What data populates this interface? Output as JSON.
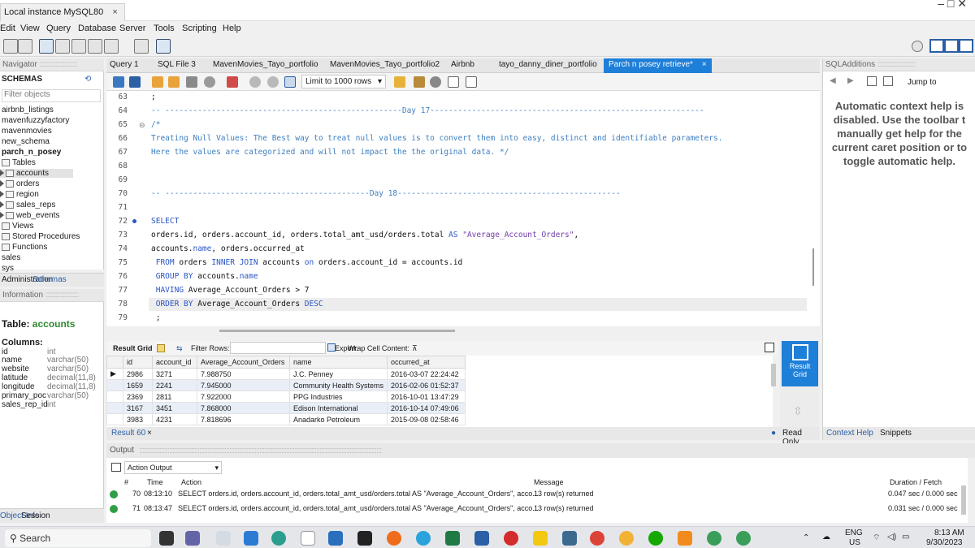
{
  "window": {
    "tab_title": "Local instance MySQL80",
    "tab_close": "×",
    "controls": "–   □   ✕"
  },
  "menu": [
    "Edit",
    "View",
    "Query",
    "Database",
    "Server",
    "Tools",
    "Scripting",
    "Help"
  ],
  "navigator": {
    "header": "Navigator",
    "schemas_label": "SCHEMAS",
    "filter_placeholder": "Filter objects",
    "items": [
      "airbnb_listings",
      "mavenfuzzyfactory",
      "mavenmovies",
      "new_schema",
      "parch_n_posey"
    ],
    "tables_label": "Tables",
    "tables": [
      "accounts",
      "orders",
      "region",
      "sales_reps",
      "web_events"
    ],
    "views_label": "Views",
    "procs_label": "Stored Procedures",
    "funcs_label": "Functions",
    "other": [
      "sales",
      "sys"
    ],
    "tabs": [
      "Administration",
      "Schemas"
    ]
  },
  "info": {
    "header": "Information",
    "table_label": "Table:",
    "table_name": "accounts",
    "columns_label": "Columns:",
    "columns": [
      {
        "name": "id",
        "type": "int"
      },
      {
        "name": "name",
        "type": "varchar(50)"
      },
      {
        "name": "website",
        "type": "varchar(50)"
      },
      {
        "name": "latitude",
        "type": "decimal(11,8)"
      },
      {
        "name": "longitude",
        "type": "decimal(11,8)"
      },
      {
        "name": "primary_poc",
        "type": "varchar(50)"
      },
      {
        "name": "sales_rep_id",
        "type": "int"
      }
    ],
    "tabs": [
      "Object Info",
      "Session"
    ]
  },
  "query_tabs": [
    "Query 1",
    "SQL File 3",
    "MavenMovies_Tayo_portfolio",
    "MavenMovies_Tayo_portfolio2",
    "Airbnb",
    "tayo_danny_diner_portfolio",
    "Parch n posey retrieve*"
  ],
  "editor_toolbar": {
    "limit": "Limit to 1000 rows"
  },
  "editor": {
    "line_numbers": [
      "63",
      "64",
      "65",
      "66",
      "67",
      "68",
      "69",
      "70",
      "71",
      "72",
      "73",
      "74",
      "75",
      "76",
      "77",
      "78",
      "79"
    ],
    "l63": ";",
    "l64": "-- ---------------------------------------------------Day 17-----------------------------------------------------------",
    "l65": "/*",
    "l66": "Treating Null Values: The Best way to treat null values is to convert them into easy, distinct and identifiable parameters.",
    "l67": "Here the values are categorized and will not impact the the original data. */",
    "l70": "-- --------------------------------------------Day 18------------------------------------------------",
    "l72_kw": "SELECT",
    "l73_a": "orders.id, orders.account_id, orders.total_amt_usd/orders.total ",
    "l73_kw": "AS",
    "l73_str": " \"Average_Account_Orders\"",
    "l73_b": ",",
    "l74_a": "accounts.",
    "l74_kw": "name",
    "l74_b": ", orders.occurred_at",
    "l75_kw1": " FROM",
    "l75_a": " orders ",
    "l75_kw2": "INNER JOIN",
    "l75_b": " accounts ",
    "l75_kw3": "on",
    "l75_c": " orders.account_id = accounts.id",
    "l76_kw": " GROUP BY",
    "l76_a": " accounts.",
    "l76_kw2": "name",
    "l77_kw": " HAVING",
    "l77_a": " Average_Account_Orders > 7",
    "l78_kw": " ORDER BY",
    "l78_a": " Average_Account_Orders ",
    "l78_kw2": "DESC",
    "l79": " ;"
  },
  "result_toolbar": {
    "grid": "Result Grid",
    "filter": "Filter Rows:",
    "export": "Export:",
    "wrap": "Wrap Cell Content:"
  },
  "result": {
    "columns": [
      "id",
      "account_id",
      "Average_Account_Orders",
      "name",
      "occurred_at"
    ],
    "rows": [
      [
        "2986",
        "3271",
        "7.988750",
        "J.C. Penney",
        "2016-03-07 22:24:42"
      ],
      [
        "1659",
        "2241",
        "7.945000",
        "Community Health Systems",
        "2016-02-06 01:52:37"
      ],
      [
        "2369",
        "2811",
        "7.922000",
        "PPG Industries",
        "2016-10-01 13:47:29"
      ],
      [
        "3167",
        "3451",
        "7.868000",
        "Edison International",
        "2016-10-14 07:49:06"
      ],
      [
        "3983",
        "4231",
        "7.818696",
        "Anadarko Petroleum",
        "2015-09-08 02:58:46"
      ]
    ],
    "tab_label": "Result 60",
    "read_only": "Read Only",
    "result_grid_btn": "Result Grid"
  },
  "sql_additions": {
    "header": "SQLAdditions",
    "jump_to": "Jump to",
    "help_text": "Automatic context help is disabled. Use the toolbar t manually get help for the current caret position or to toggle automatic help.",
    "tabs": [
      "Context Help",
      "Snippets"
    ]
  },
  "output": {
    "header": "Output",
    "selector": "Action Output",
    "columns": [
      "#",
      "Time",
      "Action",
      "Message",
      "Duration / Fetch"
    ],
    "rows": [
      {
        "num": "70",
        "time": "08:13:10",
        "action": "SELECT orders.id, orders.account_id, orders.total_amt_usd/orders.total AS \"Average_Account_Orders\", acco...",
        "message": "13 row(s) returned",
        "duration": "0.047 sec / 0.000 sec"
      },
      {
        "num": "71",
        "time": "08:13:47",
        "action": "SELECT orders.id, orders.account_id, orders.total_amt_usd/orders.total AS \"Average_Account_Orders\", acco...",
        "message": "13 row(s) returned",
        "duration": "0.031 sec / 0.000 sec"
      }
    ]
  },
  "taskbar": {
    "search": "Search",
    "lang": "ENG",
    "region": "US",
    "time": "8:13 AM",
    "date": "9/30/2023"
  }
}
